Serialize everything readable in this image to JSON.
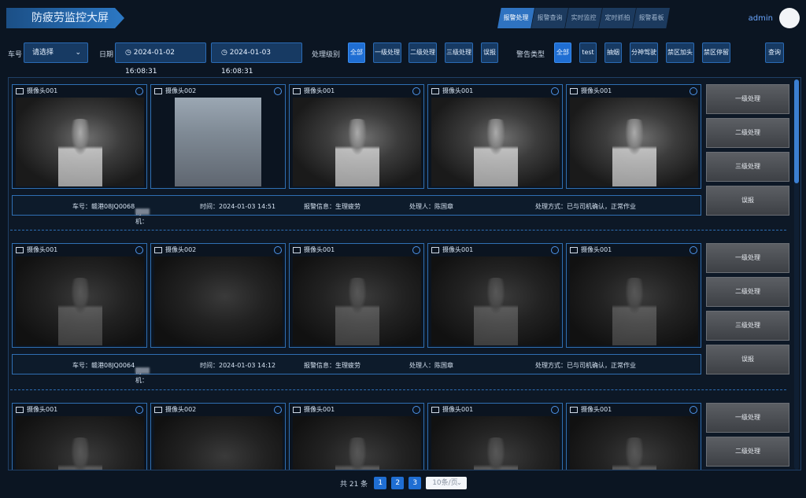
{
  "app": {
    "title": "防疲劳监控大屏"
  },
  "nav": {
    "tabs": [
      "报警处理",
      "报警查询",
      "实时监控",
      "定时抓拍",
      "报警看板"
    ],
    "active_index": 0
  },
  "user": {
    "name": "admin"
  },
  "filters": {
    "vehicle_label": "车号",
    "vehicle_select": "请选择",
    "date_label": "日期",
    "date_start": "2024-01-02 16:08:31",
    "date_end": "2024-01-03 16:08:31",
    "level_label": "处理级别",
    "levels": [
      "全部",
      "一级处理",
      "二级处理",
      "三级处理",
      "误报"
    ],
    "alarm_type_label": "警告类型",
    "types": [
      "全部",
      "test",
      "抽烟",
      "分神驾驶",
      "禁区加头",
      "禁区停留"
    ],
    "query_button": "查询"
  },
  "camera_labels": [
    "摄像头001",
    "摄像头002",
    "摄像头001",
    "摄像头001",
    "摄像头001"
  ],
  "events": [
    {
      "vehicle": "车号：赣港08JQ0068",
      "driver": "司机：",
      "time": "时间：2024-01-03 14:51",
      "alarm": "报警信息：生理疲劳",
      "handler": "处理人：陈国章",
      "method": "处理方式：已与司机确认，正常作业",
      "actions": [
        "一级处理",
        "二级处理",
        "三级处理",
        "误报"
      ]
    },
    {
      "vehicle": "车号：赣港08JQ0064",
      "driver": "司机：",
      "time": "时间：2024-01-03 14:12",
      "alarm": "报警信息：生理疲劳",
      "handler": "处理人：陈国章",
      "method": "处理方式：已与司机确认，正常作业",
      "actions": [
        "一级处理",
        "二级处理",
        "三级处理",
        "误报"
      ]
    },
    {
      "actions": [
        "一级处理",
        "二级处理"
      ]
    }
  ],
  "pagination": {
    "total": "共 21 条",
    "pages": [
      "1",
      "2",
      "3"
    ],
    "page_size": "10条/页"
  }
}
